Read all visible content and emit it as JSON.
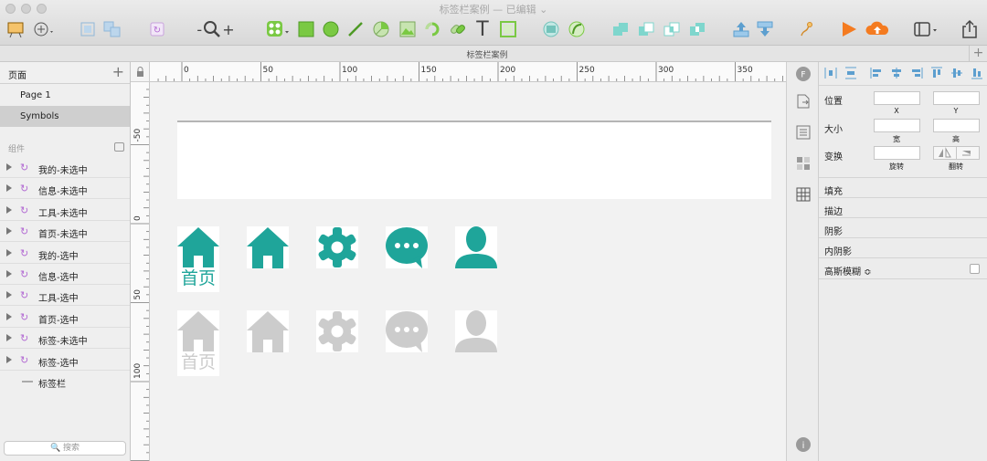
{
  "window": {
    "title": "标签栏案例 — 已编辑 ⌄",
    "tab_title": "标签栏案例",
    "tab_add": "+"
  },
  "toolbar": {
    "zoom_minus": "-",
    "zoom_plus": "+",
    "text_tool": "T"
  },
  "colors": {
    "accent": "#1fa59a",
    "inactive": "#cccccc",
    "tool_green": "#7ac943",
    "symbol_purple": "#b36bd3"
  },
  "left_panel": {
    "pages_header": "页面",
    "add": "+",
    "pages": [
      "Page 1",
      "Symbols"
    ],
    "components_header": "组件",
    "symbols": [
      "我的-未选中",
      "信息-未选中",
      "工具-未选中",
      "首页-未选中",
      "我的-选中",
      "信息-选中",
      "工具-选中",
      "首页-选中",
      "标签-未选中",
      "标签-选中",
      "标签栏"
    ],
    "search_placeholder": "🔍 搜索"
  },
  "rulers": {
    "horizontal": [
      "0",
      "50",
      "100",
      "150",
      "200",
      "250",
      "300",
      "350"
    ],
    "vertical": [
      "-50",
      "0",
      "50",
      "100"
    ]
  },
  "canvas": {
    "home_label_active": "首页",
    "home_label_inactive": "首页"
  },
  "inspector": {
    "position": "位置",
    "size": "大小",
    "transform": "变换",
    "x": "X",
    "y": "Y",
    "width": "宽",
    "height": "高",
    "rotate": "旋转",
    "flip": "翻转",
    "fill": "填充",
    "border": "描边",
    "shadow": "阴影",
    "inner_shadow": "内阴影",
    "blur": "高斯模糊 ≎"
  }
}
